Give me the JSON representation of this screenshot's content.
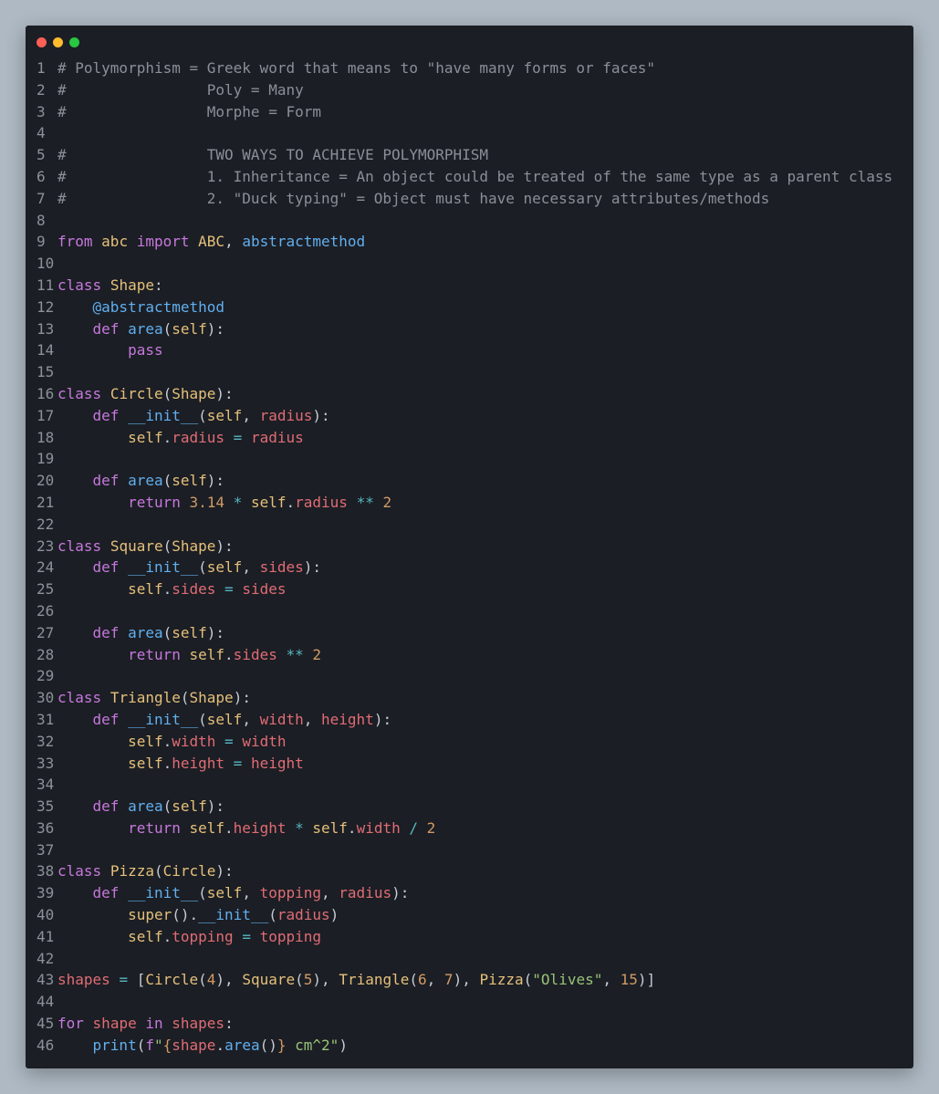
{
  "window": {
    "buttons": [
      {
        "name": "close",
        "color": "#ff5f57"
      },
      {
        "name": "minimize",
        "color": "#febc2e"
      },
      {
        "name": "maximize",
        "color": "#28c840"
      }
    ]
  },
  "colors": {
    "background": "#aeb9c3",
    "editor": "#1b1e24",
    "comment": "#8a8f98",
    "keyword": "#c678dd",
    "class": "#e5c07b",
    "function": "#61afef",
    "attribute": "#e06c75",
    "operator": "#56b6c2",
    "number": "#d19a66",
    "string": "#98c379"
  },
  "code": [
    [
      [
        "cm",
        "# Polymorphism = Greek word that means to \"have many forms or faces\""
      ]
    ],
    [
      [
        "cm",
        "#                Poly = Many"
      ]
    ],
    [
      [
        "cm",
        "#                Morphe = Form"
      ]
    ],
    [],
    [
      [
        "cm",
        "#                TWO WAYS TO ACHIEVE POLYMORPHISM"
      ]
    ],
    [
      [
        "cm",
        "#                1. Inheritance = An object could be treated of the same type as a parent class"
      ]
    ],
    [
      [
        "cm",
        "#                2. \"Duck typing\" = Object must have necessary attributes/methods"
      ]
    ],
    [],
    [
      [
        "kw",
        "from"
      ],
      [
        "p",
        " "
      ],
      [
        "cls",
        "abc"
      ],
      [
        "p",
        " "
      ],
      [
        "kw",
        "import"
      ],
      [
        "p",
        " "
      ],
      [
        "cls",
        "ABC"
      ],
      [
        "p",
        ", "
      ],
      [
        "fn",
        "abstractmethod"
      ]
    ],
    [],
    [
      [
        "kw",
        "class"
      ],
      [
        "p",
        " "
      ],
      [
        "cls",
        "Shape"
      ],
      [
        "p",
        ":"
      ]
    ],
    [
      [
        "p",
        "    "
      ],
      [
        "fn",
        "@abstractmethod"
      ]
    ],
    [
      [
        "p",
        "    "
      ],
      [
        "kw",
        "def"
      ],
      [
        "p",
        " "
      ],
      [
        "fn",
        "area"
      ],
      [
        "p",
        "("
      ],
      [
        "self",
        "self"
      ],
      [
        "p",
        "):"
      ]
    ],
    [
      [
        "p",
        "        "
      ],
      [
        "kw",
        "pass"
      ]
    ],
    [],
    [
      [
        "kw",
        "class"
      ],
      [
        "p",
        " "
      ],
      [
        "cls",
        "Circle"
      ],
      [
        "p",
        "("
      ],
      [
        "cls",
        "Shape"
      ],
      [
        "p",
        "):"
      ]
    ],
    [
      [
        "p",
        "    "
      ],
      [
        "kw",
        "def"
      ],
      [
        "p",
        " "
      ],
      [
        "fn",
        "__init__"
      ],
      [
        "p",
        "("
      ],
      [
        "self",
        "self"
      ],
      [
        "p",
        ", "
      ],
      [
        "attr",
        "radius"
      ],
      [
        "p",
        "):"
      ]
    ],
    [
      [
        "p",
        "        "
      ],
      [
        "self",
        "self"
      ],
      [
        "p",
        "."
      ],
      [
        "attr",
        "radius"
      ],
      [
        "p",
        " "
      ],
      [
        "op",
        "="
      ],
      [
        "p",
        " "
      ],
      [
        "attr",
        "radius"
      ]
    ],
    [],
    [
      [
        "p",
        "    "
      ],
      [
        "kw",
        "def"
      ],
      [
        "p",
        " "
      ],
      [
        "fn",
        "area"
      ],
      [
        "p",
        "("
      ],
      [
        "self",
        "self"
      ],
      [
        "p",
        "):"
      ]
    ],
    [
      [
        "p",
        "        "
      ],
      [
        "kw",
        "return"
      ],
      [
        "p",
        " "
      ],
      [
        "num",
        "3.14"
      ],
      [
        "p",
        " "
      ],
      [
        "op",
        "*"
      ],
      [
        "p",
        " "
      ],
      [
        "self",
        "self"
      ],
      [
        "p",
        "."
      ],
      [
        "attr",
        "radius"
      ],
      [
        "p",
        " "
      ],
      [
        "op",
        "**"
      ],
      [
        "p",
        " "
      ],
      [
        "num",
        "2"
      ]
    ],
    [],
    [
      [
        "kw",
        "class"
      ],
      [
        "p",
        " "
      ],
      [
        "cls",
        "Square"
      ],
      [
        "p",
        "("
      ],
      [
        "cls",
        "Shape"
      ],
      [
        "p",
        "):"
      ]
    ],
    [
      [
        "p",
        "    "
      ],
      [
        "kw",
        "def"
      ],
      [
        "p",
        " "
      ],
      [
        "fn",
        "__init__"
      ],
      [
        "p",
        "("
      ],
      [
        "self",
        "self"
      ],
      [
        "p",
        ", "
      ],
      [
        "attr",
        "sides"
      ],
      [
        "p",
        "):"
      ]
    ],
    [
      [
        "p",
        "        "
      ],
      [
        "self",
        "self"
      ],
      [
        "p",
        "."
      ],
      [
        "attr",
        "sides"
      ],
      [
        "p",
        " "
      ],
      [
        "op",
        "="
      ],
      [
        "p",
        " "
      ],
      [
        "attr",
        "sides"
      ]
    ],
    [],
    [
      [
        "p",
        "    "
      ],
      [
        "kw",
        "def"
      ],
      [
        "p",
        " "
      ],
      [
        "fn",
        "area"
      ],
      [
        "p",
        "("
      ],
      [
        "self",
        "self"
      ],
      [
        "p",
        "):"
      ]
    ],
    [
      [
        "p",
        "        "
      ],
      [
        "kw",
        "return"
      ],
      [
        "p",
        " "
      ],
      [
        "self",
        "self"
      ],
      [
        "p",
        "."
      ],
      [
        "attr",
        "sides"
      ],
      [
        "p",
        " "
      ],
      [
        "op",
        "**"
      ],
      [
        "p",
        " "
      ],
      [
        "num",
        "2"
      ]
    ],
    [],
    [
      [
        "kw",
        "class"
      ],
      [
        "p",
        " "
      ],
      [
        "cls",
        "Triangle"
      ],
      [
        "p",
        "("
      ],
      [
        "cls",
        "Shape"
      ],
      [
        "p",
        "):"
      ]
    ],
    [
      [
        "p",
        "    "
      ],
      [
        "kw",
        "def"
      ],
      [
        "p",
        " "
      ],
      [
        "fn",
        "__init__"
      ],
      [
        "p",
        "("
      ],
      [
        "self",
        "self"
      ],
      [
        "p",
        ", "
      ],
      [
        "attr",
        "width"
      ],
      [
        "p",
        ", "
      ],
      [
        "attr",
        "height"
      ],
      [
        "p",
        "):"
      ]
    ],
    [
      [
        "p",
        "        "
      ],
      [
        "self",
        "self"
      ],
      [
        "p",
        "."
      ],
      [
        "attr",
        "width"
      ],
      [
        "p",
        " "
      ],
      [
        "op",
        "="
      ],
      [
        "p",
        " "
      ],
      [
        "attr",
        "width"
      ]
    ],
    [
      [
        "p",
        "        "
      ],
      [
        "self",
        "self"
      ],
      [
        "p",
        "."
      ],
      [
        "attr",
        "height"
      ],
      [
        "p",
        " "
      ],
      [
        "op",
        "="
      ],
      [
        "p",
        " "
      ],
      [
        "attr",
        "height"
      ]
    ],
    [],
    [
      [
        "p",
        "    "
      ],
      [
        "kw",
        "def"
      ],
      [
        "p",
        " "
      ],
      [
        "fn",
        "area"
      ],
      [
        "p",
        "("
      ],
      [
        "self",
        "self"
      ],
      [
        "p",
        "):"
      ]
    ],
    [
      [
        "p",
        "        "
      ],
      [
        "kw",
        "return"
      ],
      [
        "p",
        " "
      ],
      [
        "self",
        "self"
      ],
      [
        "p",
        "."
      ],
      [
        "attr",
        "height"
      ],
      [
        "p",
        " "
      ],
      [
        "op",
        "*"
      ],
      [
        "p",
        " "
      ],
      [
        "self",
        "self"
      ],
      [
        "p",
        "."
      ],
      [
        "attr",
        "width"
      ],
      [
        "p",
        " "
      ],
      [
        "op",
        "/"
      ],
      [
        "p",
        " "
      ],
      [
        "num",
        "2"
      ]
    ],
    [],
    [
      [
        "kw",
        "class"
      ],
      [
        "p",
        " "
      ],
      [
        "cls",
        "Pizza"
      ],
      [
        "p",
        "("
      ],
      [
        "cls",
        "Circle"
      ],
      [
        "p",
        "):"
      ]
    ],
    [
      [
        "p",
        "    "
      ],
      [
        "kw",
        "def"
      ],
      [
        "p",
        " "
      ],
      [
        "fn",
        "__init__"
      ],
      [
        "p",
        "("
      ],
      [
        "self",
        "self"
      ],
      [
        "p",
        ", "
      ],
      [
        "attr",
        "topping"
      ],
      [
        "p",
        ", "
      ],
      [
        "attr",
        "radius"
      ],
      [
        "p",
        "):"
      ]
    ],
    [
      [
        "p",
        "        "
      ],
      [
        "self",
        "super"
      ],
      [
        "p",
        "()."
      ],
      [
        "fn",
        "__init__"
      ],
      [
        "p",
        "("
      ],
      [
        "attr",
        "radius"
      ],
      [
        "p",
        ")"
      ]
    ],
    [
      [
        "p",
        "        "
      ],
      [
        "self",
        "self"
      ],
      [
        "p",
        "."
      ],
      [
        "attr",
        "topping"
      ],
      [
        "p",
        " "
      ],
      [
        "op",
        "="
      ],
      [
        "p",
        " "
      ],
      [
        "attr",
        "topping"
      ]
    ],
    [],
    [
      [
        "attr",
        "shapes"
      ],
      [
        "p",
        " "
      ],
      [
        "op",
        "="
      ],
      [
        "p",
        " ["
      ],
      [
        "self",
        "Circle"
      ],
      [
        "p",
        "("
      ],
      [
        "num",
        "4"
      ],
      [
        "p",
        "), "
      ],
      [
        "self",
        "Square"
      ],
      [
        "p",
        "("
      ],
      [
        "num",
        "5"
      ],
      [
        "p",
        "), "
      ],
      [
        "self",
        "Triangle"
      ],
      [
        "p",
        "("
      ],
      [
        "num",
        "6"
      ],
      [
        "p",
        ", "
      ],
      [
        "num",
        "7"
      ],
      [
        "p",
        "), "
      ],
      [
        "self",
        "Pizza"
      ],
      [
        "p",
        "("
      ],
      [
        "str",
        "\"Olives\""
      ],
      [
        "p",
        ", "
      ],
      [
        "num",
        "15"
      ],
      [
        "p",
        ")]"
      ]
    ],
    [],
    [
      [
        "kw",
        "for"
      ],
      [
        "p",
        " "
      ],
      [
        "attr",
        "shape"
      ],
      [
        "p",
        " "
      ],
      [
        "kw",
        "in"
      ],
      [
        "p",
        " "
      ],
      [
        "attr",
        "shapes"
      ],
      [
        "p",
        ":"
      ]
    ],
    [
      [
        "p",
        "    "
      ],
      [
        "fn",
        "print"
      ],
      [
        "p",
        "("
      ],
      [
        "kw",
        "f"
      ],
      [
        "str",
        "\""
      ],
      [
        "num",
        "{"
      ],
      [
        "attr",
        "shape"
      ],
      [
        "p",
        "."
      ],
      [
        "fn",
        "area"
      ],
      [
        "p",
        "()"
      ],
      [
        "num",
        "}"
      ],
      [
        "str",
        " cm^2\""
      ],
      [
        "p",
        ")"
      ]
    ]
  ]
}
